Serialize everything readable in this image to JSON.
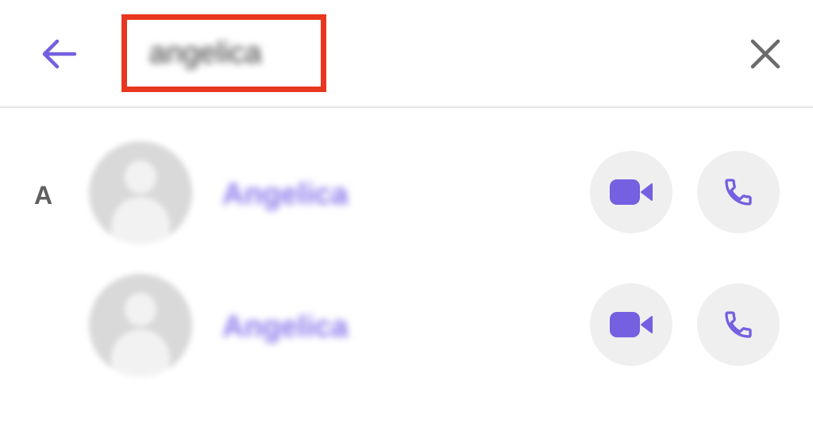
{
  "search": {
    "query": "angelica",
    "back_icon": "arrow-left-icon",
    "clear_icon": "close-icon"
  },
  "colors": {
    "accent": "#7460e0",
    "highlight_border": "#e8371f",
    "button_bg": "#efefef",
    "name_text": "#8b79ec"
  },
  "results": {
    "section_letter": "A",
    "contacts": [
      {
        "name": "Angelica",
        "video_icon": "video-camera-icon",
        "call_icon": "phone-icon"
      },
      {
        "name": "Angelica",
        "video_icon": "video-camera-icon",
        "call_icon": "phone-icon"
      }
    ]
  }
}
